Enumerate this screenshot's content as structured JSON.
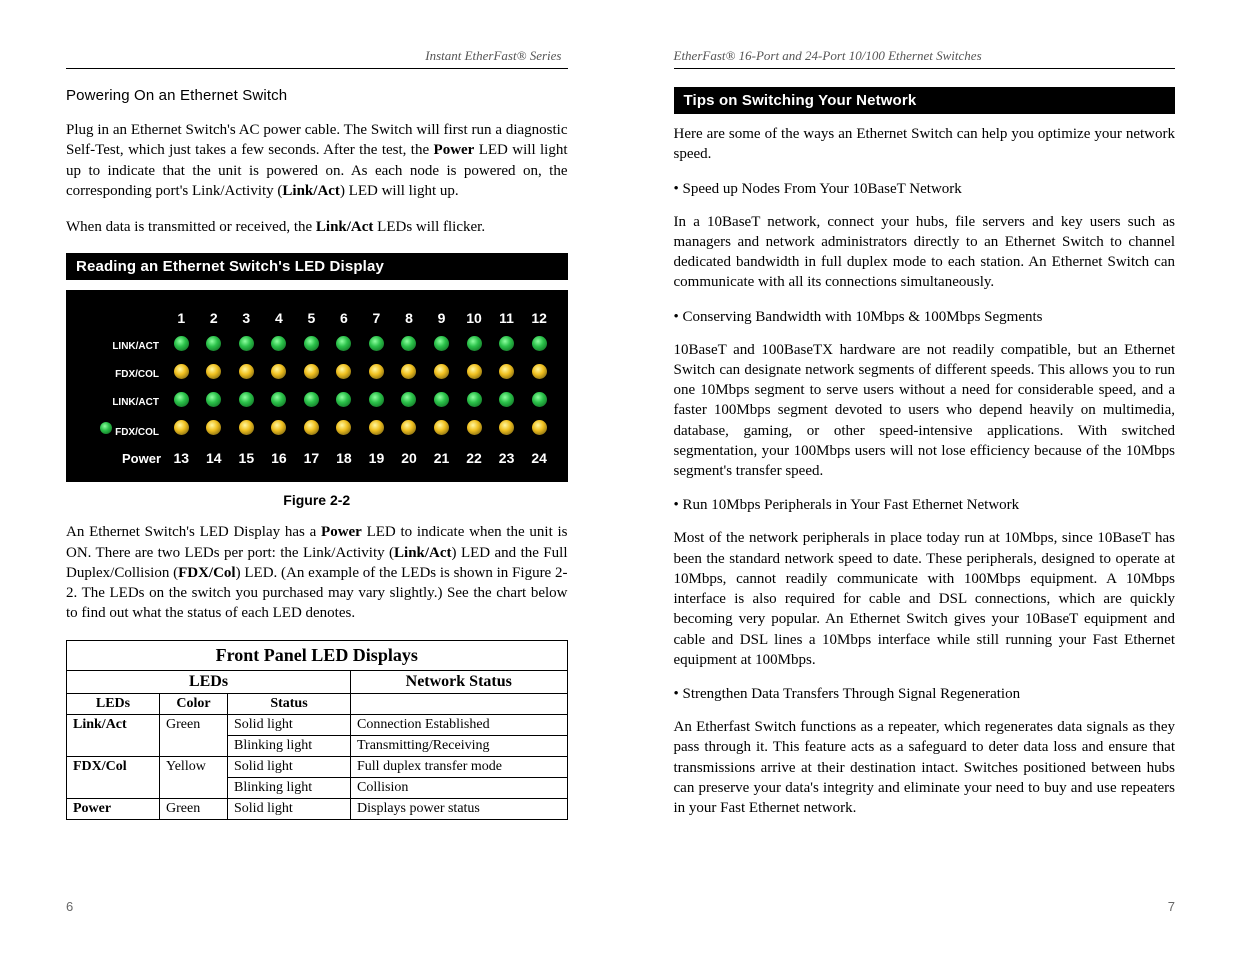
{
  "left": {
    "header": "Instant EtherFast® Series",
    "subheading": "Powering On an Ethernet Switch",
    "para1_a": "Plug in an Ethernet Switch's AC power cable. The Switch will first run a diagnostic Self-Test, which just takes a few seconds.  After the test, the ",
    "para1_bold1": "Power",
    "para1_b": " LED will light up to indicate that the unit is powered on.  As each node is powered on, the corresponding port's Link/Activity (",
    "para1_bold2": "Link/Act",
    "para1_c": ") LED will light up.",
    "para2_a": "When data is transmitted or received, the ",
    "para2_bold": "Link/Act",
    "para2_b": " LEDs will flicker.",
    "bar": "Reading an Ethernet Switch's LED Display",
    "led_labels": {
      "linkact": "LINK/ACT",
      "fdxcol": "FDX/COL",
      "power": "Power"
    },
    "led_top_nums": [
      "1",
      "2",
      "3",
      "4",
      "5",
      "6",
      "7",
      "8",
      "9",
      "10",
      "11",
      "12"
    ],
    "led_bot_nums": [
      "13",
      "14",
      "15",
      "16",
      "17",
      "18",
      "19",
      "20",
      "21",
      "22",
      "23",
      "24"
    ],
    "figcap": "Figure 2-2",
    "para3_a": "An Ethernet Switch's LED Display has a ",
    "para3_bold1": "Power",
    "para3_b": " LED to indicate when the unit is ON.  There are two LEDs per port: the Link/Activity (",
    "para3_bold2": "Link/Act",
    "para3_c": ") LED and the Full Duplex/Collision (",
    "para3_bold3": "FDX/Col",
    "para3_d": ") LED.  (An example of the LEDs is shown in Figure 2-2. The LEDs on the switch you purchased may vary slightly.) See the chart below to find out what the status of each LED denotes.",
    "table": {
      "title": "Front Panel LED Displays",
      "group_leds": "LEDs",
      "group_net": "Network Status",
      "col_leds": "LEDs",
      "col_color": "Color",
      "col_status": "Status",
      "rows": [
        {
          "led": "Link/Act",
          "color": "Green",
          "status": "Solid light",
          "net": "Connection Established"
        },
        {
          "led": "",
          "color": "",
          "status": "Blinking light",
          "net": "Transmitting/Receiving"
        },
        {
          "led": "FDX/Col",
          "color": "Yellow",
          "status": "Solid light",
          "net": "Full duplex transfer mode"
        },
        {
          "led": "",
          "color": "",
          "status": "Blinking light",
          "net": "Collision"
        },
        {
          "led": "Power",
          "color": "Green",
          "status": "Solid light",
          "net": "Displays power status"
        }
      ]
    },
    "pagenum": "6"
  },
  "right": {
    "header": "EtherFast® 16-Port and 24-Port 10/100 Ethernet Switches",
    "bar": "Tips on Switching Your Network",
    "intro": "Here are some of the ways an Ethernet Switch can help you optimize your network speed.",
    "b1": "• Speed up Nodes From Your 10BaseT Network",
    "p1": "In a 10BaseT network, connect your hubs, file servers and key users such as managers and network administrators directly to an Ethernet Switch to channel dedicated bandwidth in full duplex mode to each station.  An Ethernet Switch can communicate with all its connections simultaneously.",
    "b2": "• Conserving Bandwidth with 10Mbps & 100Mbps Segments",
    "p2": "10BaseT and 100BaseTX hardware are not readily compatible, but an Ethernet Switch can designate network segments of different speeds.  This allows you to run one 10Mbps segment to serve users without a need for considerable speed, and a faster 100Mbps segment devoted to users who depend heavily on multimedia, database, gaming, or other speed-intensive applications.  With switched segmentation, your 100Mbps users will not lose efficiency because of the 10Mbps segment's transfer speed.",
    "b3": "• Run 10Mbps Peripherals in Your Fast Ethernet Network",
    "p3": "Most of the network peripherals in place today run at 10Mbps, since 10BaseT has been the standard network speed to date. These peripherals, designed to operate at 10Mbps, cannot readily communicate with 100Mbps equipment. A 10Mbps interface is also required for cable and DSL connections, which are quickly becoming very popular.  An Ethernet Switch gives your 10BaseT equipment and cable and DSL lines a 10Mbps interface while still running your Fast Ethernet equipment at 100Mbps.",
    "b4": "• Strengthen Data Transfers Through Signal Regeneration",
    "p4": "An Etherfast Switch functions as a repeater, which regenerates data signals as they pass through it.  This feature acts as a safeguard to deter data loss and ensure that transmissions arrive at their destination intact.  Switches positioned between hubs can preserve your data's integrity and eliminate your need to buy and use repeaters in your Fast Ethernet network.",
    "pagenum": "7"
  }
}
